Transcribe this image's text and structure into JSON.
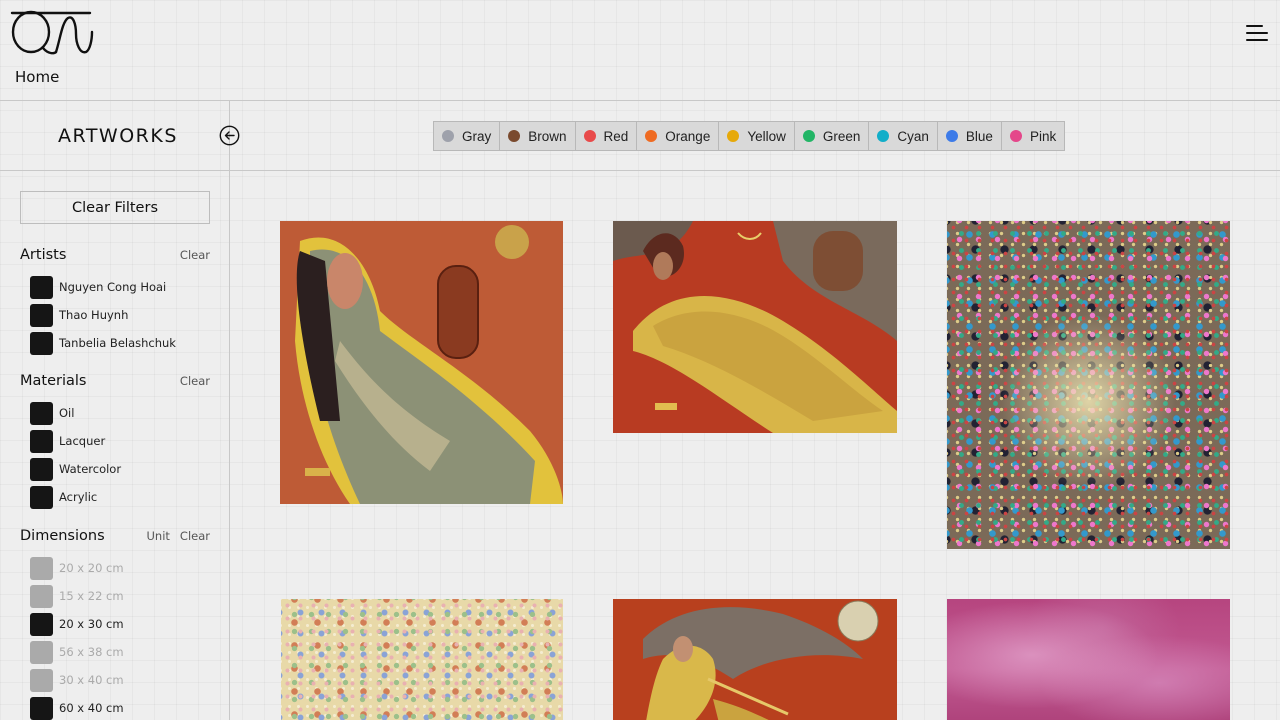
{
  "header": {
    "logo_icon": "qn-monogram-logo",
    "menu_icon": "hamburger-menu-icon",
    "home_label": "Home"
  },
  "toolbar": {
    "title": "ARTWORKS",
    "back_icon": "arrow-left-circle-icon",
    "colors": [
      {
        "label": "Gray",
        "color": "#9ea1ab"
      },
      {
        "label": "Brown",
        "color": "#7a4a2e"
      },
      {
        "label": "Red",
        "color": "#e84a4a"
      },
      {
        "label": "Orange",
        "color": "#ef6b22"
      },
      {
        "label": "Yellow",
        "color": "#e6a90a"
      },
      {
        "label": "Green",
        "color": "#22b566"
      },
      {
        "label": "Cyan",
        "color": "#12aec9"
      },
      {
        "label": "Blue",
        "color": "#3d7be8"
      },
      {
        "label": "Pink",
        "color": "#e4478a"
      }
    ]
  },
  "filters": {
    "clear_all_label": "Clear Filters",
    "clear_label": "Clear",
    "unit_label": "Unit",
    "artists": {
      "title": "Artists",
      "options": [
        "Nguyen Cong Hoai",
        "Thao Huynh",
        "Tanbelia Belashchuk"
      ]
    },
    "materials": {
      "title": "Materials",
      "options": [
        "Oil",
        "Lacquer",
        "Watercolor",
        "Acrylic"
      ]
    },
    "dimensions": {
      "title": "Dimensions",
      "options": [
        {
          "label": "20 x 20 cm",
          "enabled": false
        },
        {
          "label": "15 x 22 cm",
          "enabled": false
        },
        {
          "label": "20 x 30 cm",
          "enabled": true
        },
        {
          "label": "56 x 38 cm",
          "enabled": false
        },
        {
          "label": "30 x 40 cm",
          "enabled": false
        },
        {
          "label": "60 x 40 cm",
          "enabled": true
        }
      ]
    }
  },
  "gallery": {
    "artworks": [
      {
        "name": "artwork-woman-with-birdcage"
      },
      {
        "name": "artwork-reclining-woman-red"
      },
      {
        "name": "artwork-colorful-dot-mosaic"
      },
      {
        "name": "artwork-pastel-dot-mosaic"
      },
      {
        "name": "artwork-woman-with-flute-moon"
      },
      {
        "name": "artwork-pink-abstract"
      }
    ]
  }
}
